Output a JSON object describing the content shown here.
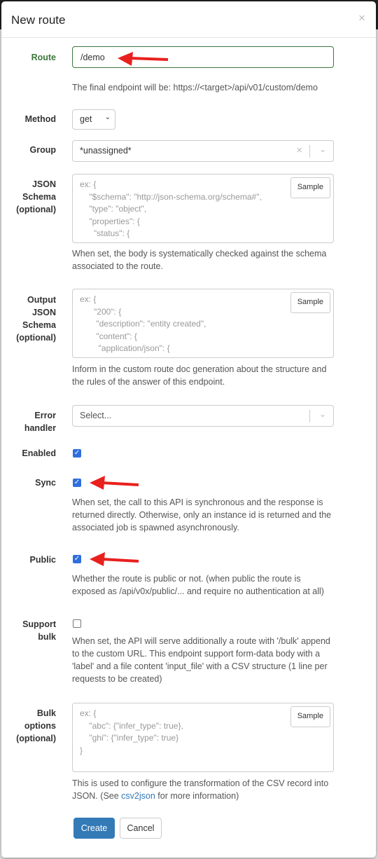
{
  "modal": {
    "title": "New route",
    "close": "×"
  },
  "route": {
    "label": "Route",
    "value": "/demo",
    "help": "The final endpoint will be: https://<target>/api/v01/custom/demo"
  },
  "method": {
    "label": "Method",
    "value": "get"
  },
  "group": {
    "label": "Group",
    "value": "*unassigned*"
  },
  "json_schema": {
    "label_lines": [
      "JSON",
      "Schema",
      "(optional)"
    ],
    "placeholder": "ex: {\n    \"$schema\": \"http://json-schema.org/schema#\",\n    \"type\": \"object\",\n    \"properties\": {\n      \"status\": {",
    "sample": "Sample",
    "help": "When set, the body is systematically checked against the schema associated to the route."
  },
  "output_schema": {
    "label_lines": [
      "Output",
      "JSON",
      "Schema",
      "(optional)"
    ],
    "placeholder": "ex: {\n      \"200\": {\n       \"description\": \"entity created\",\n       \"content\": {\n        \"application/json\": {",
    "sample": "Sample",
    "help": "Inform in the custom route doc generation about the structure and the rules of the answer of this endpoint."
  },
  "error_handler": {
    "label_lines": [
      "Error",
      "handler"
    ],
    "placeholder": "Select..."
  },
  "enabled": {
    "label": "Enabled",
    "checked": true
  },
  "sync": {
    "label": "Sync",
    "checked": true,
    "help": "When set, the call to this API is synchronous and the response is returned directly. Otherwise, only an instance id is returned and the associated job is spawned asynchronously."
  },
  "public": {
    "label": "Public",
    "checked": true,
    "help": "Whether the route is public or not. (when public the route is exposed as /api/v0x/public/... and require no authentication at all)"
  },
  "support_bulk": {
    "label_lines": [
      "Support",
      "bulk"
    ],
    "checked": false,
    "help": "When set, the API will serve additionally a route with '/bulk' append to the custom URL. This endpoint support form-data body with a 'label' and a file content 'input_file' with a CSV structure (1 line per requests to be created)"
  },
  "bulk_options": {
    "label_lines": [
      "Bulk",
      "options",
      "(optional)"
    ],
    "placeholder": "ex: {\n    \"abc\": {\"infer_type\": true},\n    \"ghi\": {\"infer_type\": true}\n}",
    "sample": "Sample",
    "help_pre": "This is used to configure the transformation of the CSV record into JSON. (See ",
    "help_link": "csv2json",
    "help_post": " for more information)"
  },
  "buttons": {
    "create": "Create",
    "cancel": "Cancel"
  },
  "colors": {
    "primary": "#337ab7",
    "success_label": "#3c763d",
    "arrow": "#e8201e",
    "checkbox": "#2f6fdd"
  }
}
